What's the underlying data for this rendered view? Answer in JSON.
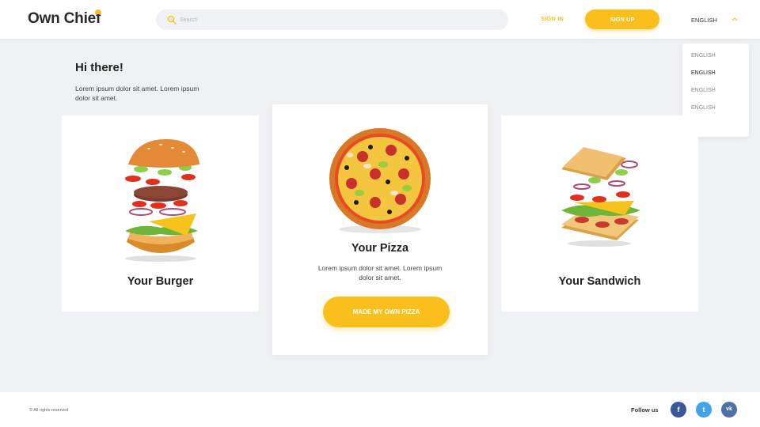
{
  "header": {
    "logo_text": "Own Chief",
    "search_placeholder": "Search",
    "signin_label": "SIGN IN",
    "signup_label": "SIGN UP",
    "language_selected": "ENGLISH"
  },
  "language_dropdown": {
    "options": [
      "ENGLISH",
      "ENGLISH",
      "ENGLISH",
      "ENGLISH"
    ],
    "active_index": 1
  },
  "hero": {
    "greeting": "Hi there!",
    "intro": "Lorem ipsum dolor sit amet. Lorem ipsum dolor sit amet."
  },
  "cards": {
    "burger": {
      "title": "Your Burger"
    },
    "pizza": {
      "title": "Your Pizza",
      "description": "Lorem ipsum dolor sit amet. Lorem ipsum dolor sit amet.",
      "cta_label": "MADE MY OWN PIZZA"
    },
    "sandwich": {
      "title": "Your Sandwich"
    }
  },
  "footer": {
    "copyright": "© All rights reserved",
    "follow_label": "Follow us",
    "socials": [
      {
        "icon": "facebook-icon",
        "glyph": "f"
      },
      {
        "icon": "twitter-icon",
        "glyph": "t"
      },
      {
        "icon": "vk-icon",
        "glyph": "vk"
      }
    ]
  },
  "colors": {
    "accent": "#fbbf1d",
    "background": "#f0f1f4",
    "facebook": "#3b5998",
    "twitter": "#3ea6e8",
    "vk": "#4f72a3"
  }
}
